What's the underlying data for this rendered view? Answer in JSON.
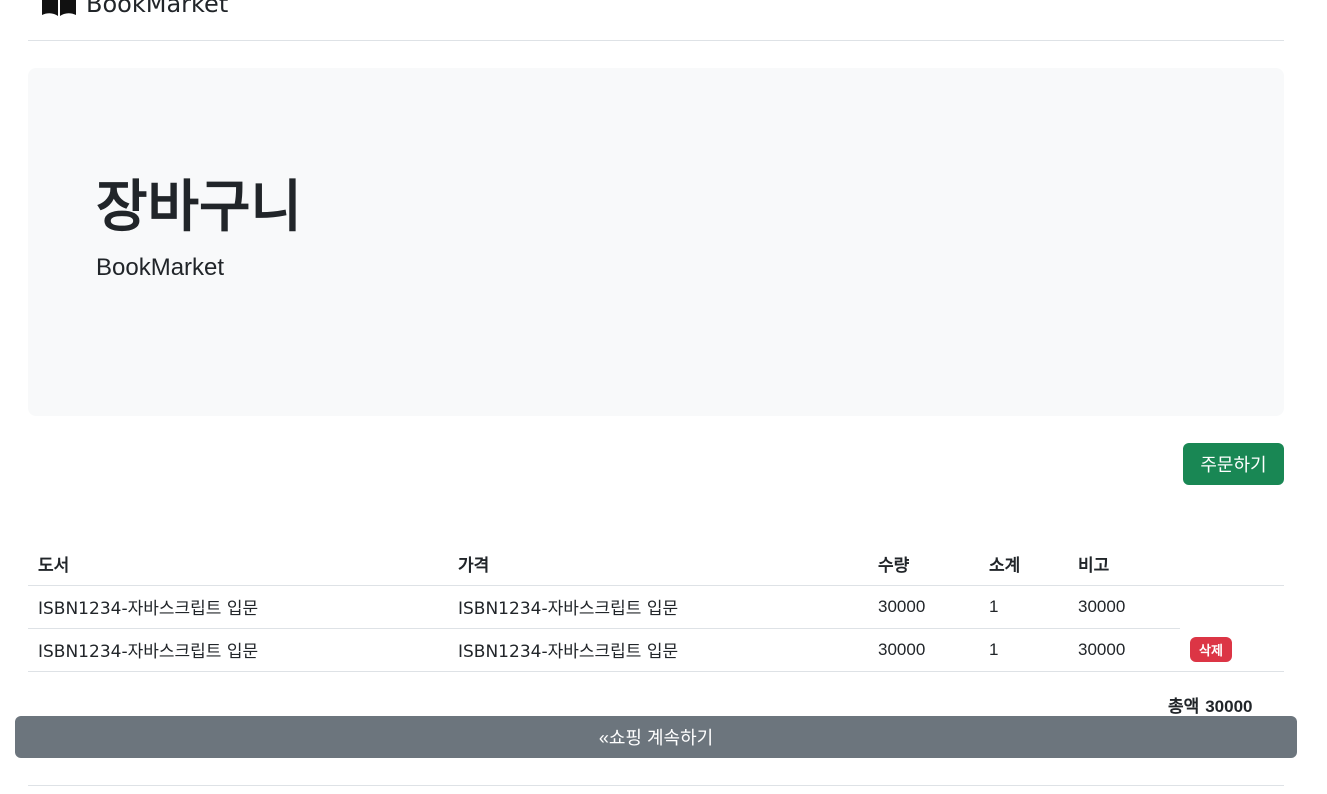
{
  "header": {
    "brand": "BookMarket",
    "brand_icon": "book-icon"
  },
  "hero": {
    "title": "장바구니",
    "subtitle": "BookMarket"
  },
  "actions": {
    "order_label": "주문하기",
    "continue_label": "«쇼핑 계속하기"
  },
  "table": {
    "headers": [
      "도서",
      "가격",
      "수량",
      "소계",
      "비고"
    ],
    "rows": [
      {
        "book": "ISBN1234-자바스크립트 입문",
        "price": "ISBN1234-자바스크립트 입문",
        "qty": "30000",
        "subtotal": "1",
        "note": "30000",
        "action": ""
      },
      {
        "book": "ISBN1234-자바스크립트 입문",
        "price": "ISBN1234-자바스크립트 입문",
        "qty": "30000",
        "subtotal": "1",
        "note": "30000",
        "action": "삭제"
      }
    ]
  },
  "total": {
    "label": "총액",
    "value": "30000"
  },
  "colors": {
    "success": "#198754",
    "danger": "#dc3545",
    "secondary": "#6c757d",
    "hero_bg": "#f8f9fa"
  }
}
